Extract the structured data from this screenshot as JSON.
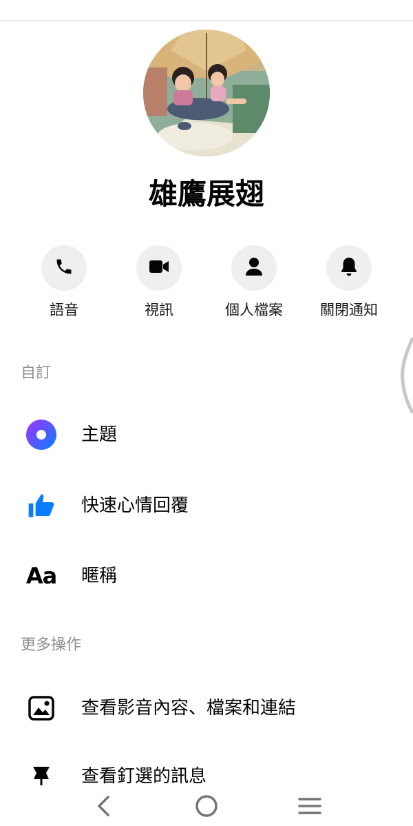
{
  "profile": {
    "name": "雄鷹展翅"
  },
  "actions": [
    {
      "label": "語音",
      "icon": "phone-icon"
    },
    {
      "label": "視訊",
      "icon": "video-camera-icon"
    },
    {
      "label": "個人檔案",
      "icon": "person-icon"
    },
    {
      "label": "關閉通知",
      "icon": "bell-icon"
    }
  ],
  "sections": {
    "customize": {
      "title": "自訂",
      "items": [
        {
          "label": "主題",
          "icon": "theme-icon"
        },
        {
          "label": "快速心情回覆",
          "icon": "thumbs-up-icon"
        },
        {
          "label": "暱稱",
          "icon": "nickname-icon",
          "icon_text": "Aa"
        }
      ]
    },
    "more_actions": {
      "title": "更多操作",
      "items": [
        {
          "label": "查看影音內容、檔案和連結",
          "icon": "image-icon"
        },
        {
          "label": "查看釘選的訊息",
          "icon": "pin-icon"
        }
      ]
    }
  },
  "colors": {
    "accent_blue": "#0a7cff",
    "theme_gradient_start": "#a033ff",
    "theme_gradient_end": "#0a7cff"
  },
  "system_nav": [
    {
      "icon": "back-icon"
    },
    {
      "icon": "home-icon"
    },
    {
      "icon": "menu-icon"
    }
  ]
}
